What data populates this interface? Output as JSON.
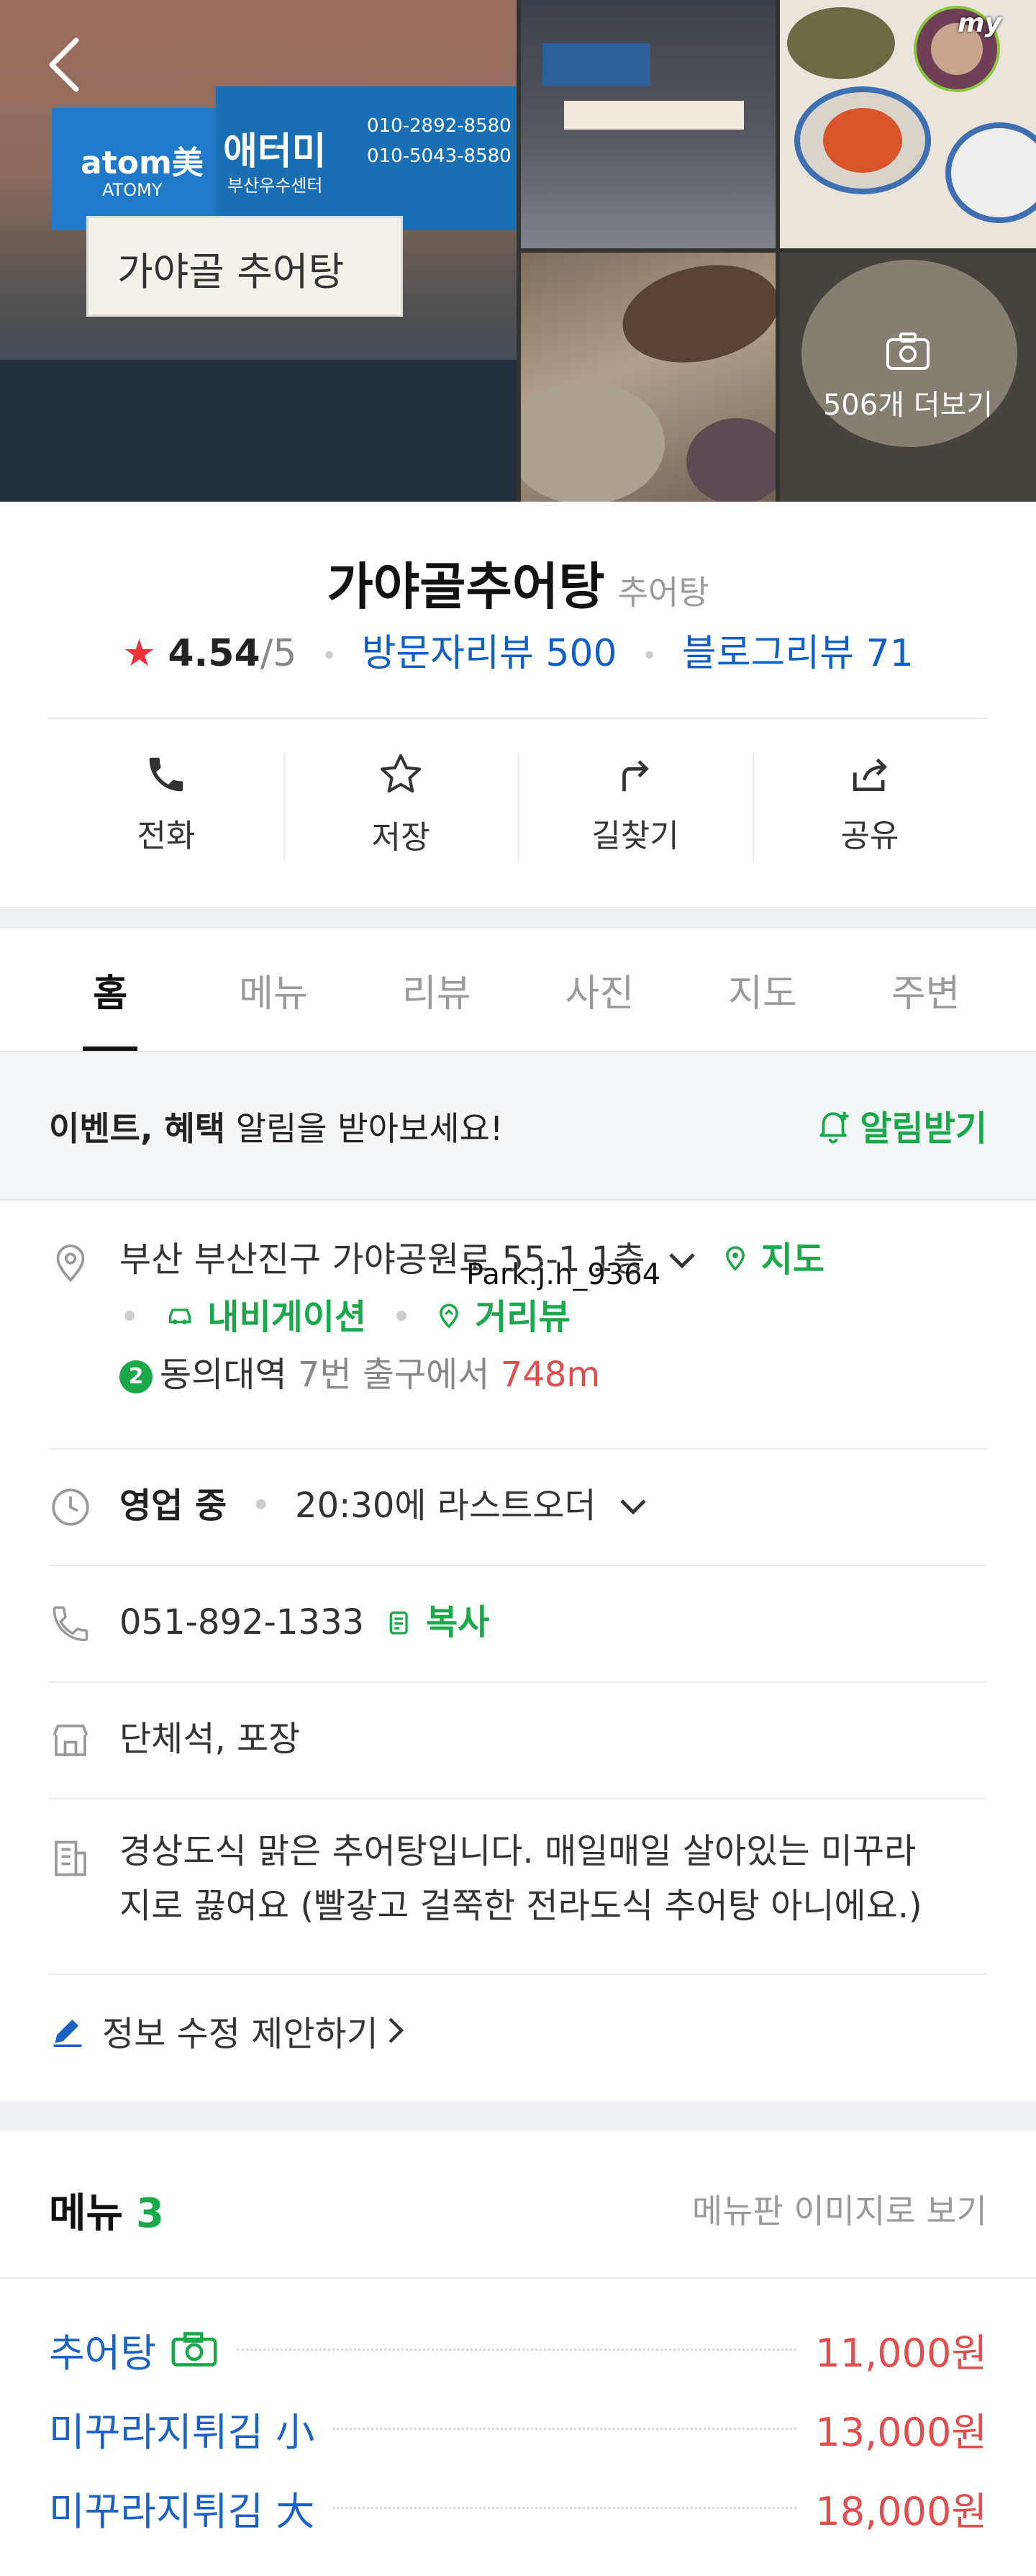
{
  "hero": {
    "sign_brand": "atom美",
    "sign_brand_sub": "ATOMY",
    "sign_center": "애터미",
    "sign_center_sub": "부산우수센터",
    "sign_phone1": "010-2892-8580",
    "sign_phone2": "010-5043-8580",
    "banner_text": "가야골 추어탕",
    "my_badge": "my",
    "more_photos": "506개 더보기"
  },
  "place": {
    "name": "가야골추어탕",
    "category": "추어탕",
    "rating": "4.54",
    "rating_max": "/5",
    "visitor_reviews": "방문자리뷰 500",
    "blog_reviews": "블로그리뷰 71"
  },
  "actions": [
    {
      "label": "전화",
      "icon": "phone-icon"
    },
    {
      "label": "저장",
      "icon": "star-outline-icon"
    },
    {
      "label": "길찾기",
      "icon": "directions-icon"
    },
    {
      "label": "공유",
      "icon": "share-icon"
    }
  ],
  "tabs": [
    "홈",
    "메뉴",
    "리뷰",
    "사진",
    "지도",
    "주변"
  ],
  "alert": {
    "bold": "이벤트, 혜택",
    "text": " 알림을 받아보세요!",
    "button": "알림받기"
  },
  "info": {
    "address": "부산 부산진구 가야공원로 55-1 1층",
    "map_link": "지도",
    "navigation_link": "내비게이션",
    "street_view_link": "거리뷰",
    "watermark": "Park.j.h_9364",
    "subway_line": "2",
    "subway_station": "동의대역",
    "subway_exit": "7번 출구에서",
    "subway_distance": "748m",
    "hours_status": "영업 중",
    "hours_detail": "20:30에 라스트오더",
    "phone": "051-892-1333",
    "copy": "복사",
    "facilities": "단체석, 포장",
    "description_line1": "경상도식 맑은 추어탕입니다. 매일매일 살아있는 미꾸라",
    "description_line2": "지로 끓여요 (빨갛고 걸쭉한 전라도식 추어탕 아니에요.)",
    "suggest_edit": "정보 수정 제안하기"
  },
  "menu": {
    "title": "메뉴",
    "count": "3",
    "image_link": "메뉴판 이미지로 보기",
    "items": [
      {
        "name": "추어탕",
        "price": "11,000원",
        "has_photo": true
      },
      {
        "name": "미꾸라지튀김 小",
        "price": "13,000원",
        "has_photo": false
      },
      {
        "name": "미꾸라지튀김 大",
        "price": "18,000원",
        "has_photo": false
      }
    ]
  },
  "colors": {
    "accent_green": "#1aa84a",
    "link_blue": "#1060c8",
    "price_red": "#e04e4e",
    "star_red": "#f0323c"
  }
}
